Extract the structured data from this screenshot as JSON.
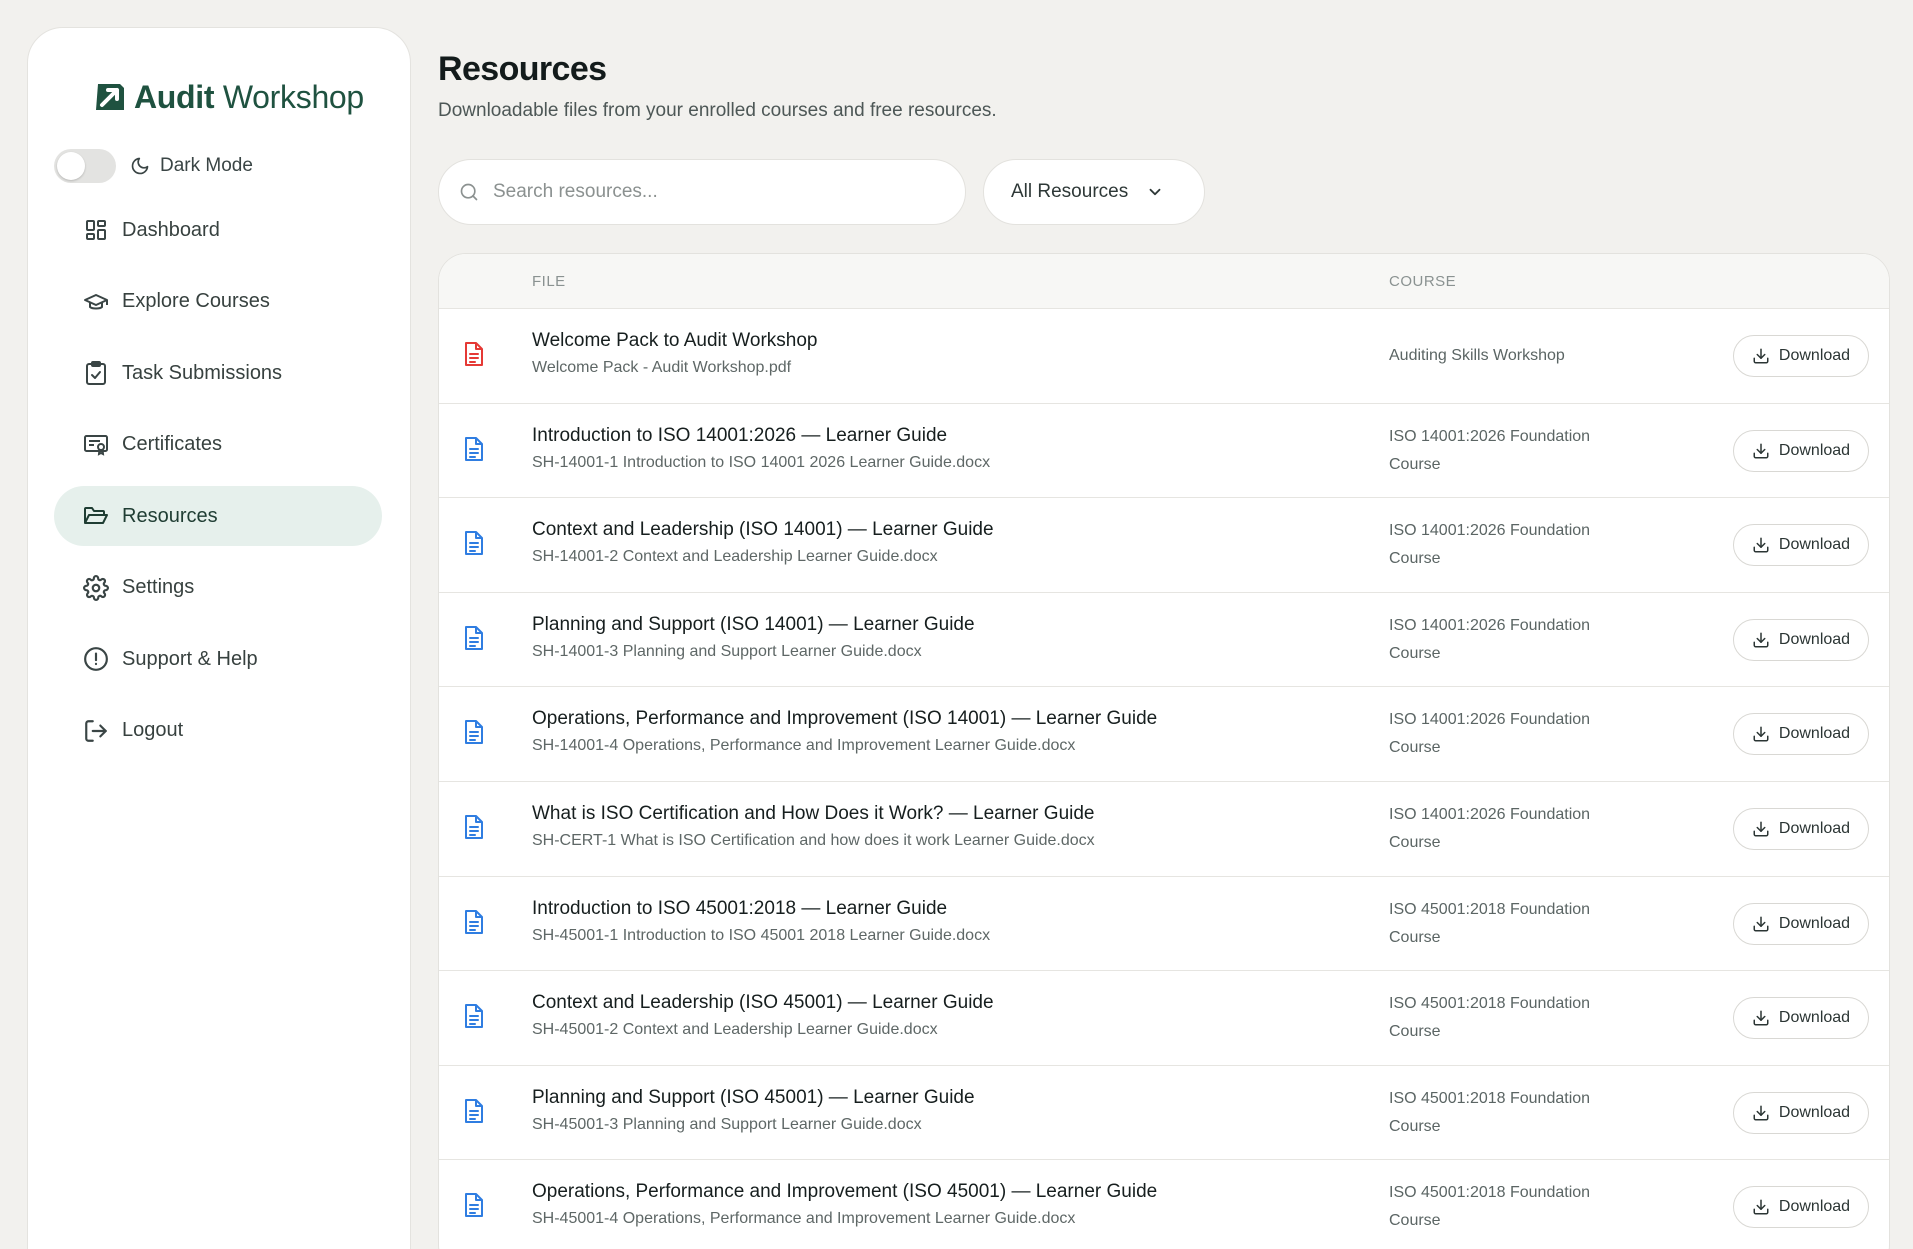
{
  "brand": {
    "name_bold": "Audit",
    "name_light": "Workshop",
    "accent": "#1f5240"
  },
  "sidebar": {
    "dark_mode_label": "Dark Mode",
    "items": [
      {
        "label": "Dashboard",
        "icon": "dashboard-icon",
        "active": false
      },
      {
        "label": "Explore Courses",
        "icon": "graduation-cap-icon",
        "active": false
      },
      {
        "label": "Task Submissions",
        "icon": "clipboard-check-icon",
        "active": false
      },
      {
        "label": "Certificates",
        "icon": "certificate-icon",
        "active": false
      },
      {
        "label": "Resources",
        "icon": "folder-open-icon",
        "active": true
      },
      {
        "label": "Settings",
        "icon": "gear-icon",
        "active": false
      },
      {
        "label": "Support & Help",
        "icon": "alert-circle-icon",
        "active": false
      },
      {
        "label": "Logout",
        "icon": "logout-icon",
        "active": false
      }
    ]
  },
  "page": {
    "title": "Resources",
    "subtitle": "Downloadable files from your enrolled courses and free resources."
  },
  "search": {
    "placeholder": "Search resources...",
    "value": ""
  },
  "filter": {
    "selected": "All Resources"
  },
  "table": {
    "columns": {
      "file": "FILE",
      "course": "COURSE"
    },
    "download_label": "Download",
    "rows": [
      {
        "title": "Welcome Pack to Audit Workshop",
        "filename": "Welcome Pack - Audit Workshop.pdf",
        "course": "Auditing Skills Workshop",
        "type": "pdf"
      },
      {
        "title": "Introduction to ISO 14001:2026 — Learner Guide",
        "filename": "SH-14001-1 Introduction to ISO 14001 2026 Learner Guide.docx",
        "course_line1": "ISO 14001:2026 Foundation",
        "course_line2": "Course",
        "type": "doc"
      },
      {
        "title": "Context and Leadership (ISO 14001) — Learner Guide",
        "filename": "SH-14001-2 Context and Leadership Learner Guide.docx",
        "course_line1": "ISO 14001:2026 Foundation",
        "course_line2": "Course",
        "type": "doc"
      },
      {
        "title": "Planning and Support (ISO 14001) — Learner Guide",
        "filename": "SH-14001-3 Planning and Support Learner Guide.docx",
        "course_line1": "ISO 14001:2026 Foundation",
        "course_line2": "Course",
        "type": "doc"
      },
      {
        "title": "Operations, Performance and Improvement (ISO 14001) — Learner Guide",
        "filename": "SH-14001-4 Operations, Performance and Improvement Learner Guide.docx",
        "course_line1": "ISO 14001:2026 Foundation",
        "course_line2": "Course",
        "type": "doc"
      },
      {
        "title": "What is ISO Certification and How Does it Work? — Learner Guide",
        "filename": "SH-CERT-1 What is ISO Certification and how does it work Learner Guide.docx",
        "course_line1": "ISO 14001:2026 Foundation",
        "course_line2": "Course",
        "type": "doc"
      },
      {
        "title": "Introduction to ISO 45001:2018 — Learner Guide",
        "filename": "SH-45001-1 Introduction to ISO 45001 2018 Learner Guide.docx",
        "course_line1": "ISO 45001:2018 Foundation",
        "course_line2": "Course",
        "type": "doc"
      },
      {
        "title": "Context and Leadership (ISO 45001) — Learner Guide",
        "filename": "SH-45001-2 Context and Leadership Learner Guide.docx",
        "course_line1": "ISO 45001:2018 Foundation",
        "course_line2": "Course",
        "type": "doc"
      },
      {
        "title": "Planning and Support (ISO 45001) — Learner Guide",
        "filename": "SH-45001-3 Planning and Support Learner Guide.docx",
        "course_line1": "ISO 45001:2018 Foundation",
        "course_line2": "Course",
        "type": "doc"
      },
      {
        "title": "Operations, Performance and Improvement (ISO 45001) — Learner Guide",
        "filename": "SH-45001-4 Operations, Performance and Improvement Learner Guide.docx",
        "course_line1": "ISO 45001:2018 Foundation",
        "course_line2": "Course",
        "type": "doc"
      }
    ]
  },
  "colors": {
    "pdf": "#e53935",
    "doc": "#2f7de1",
    "active_bg": "#e6f0ec"
  }
}
